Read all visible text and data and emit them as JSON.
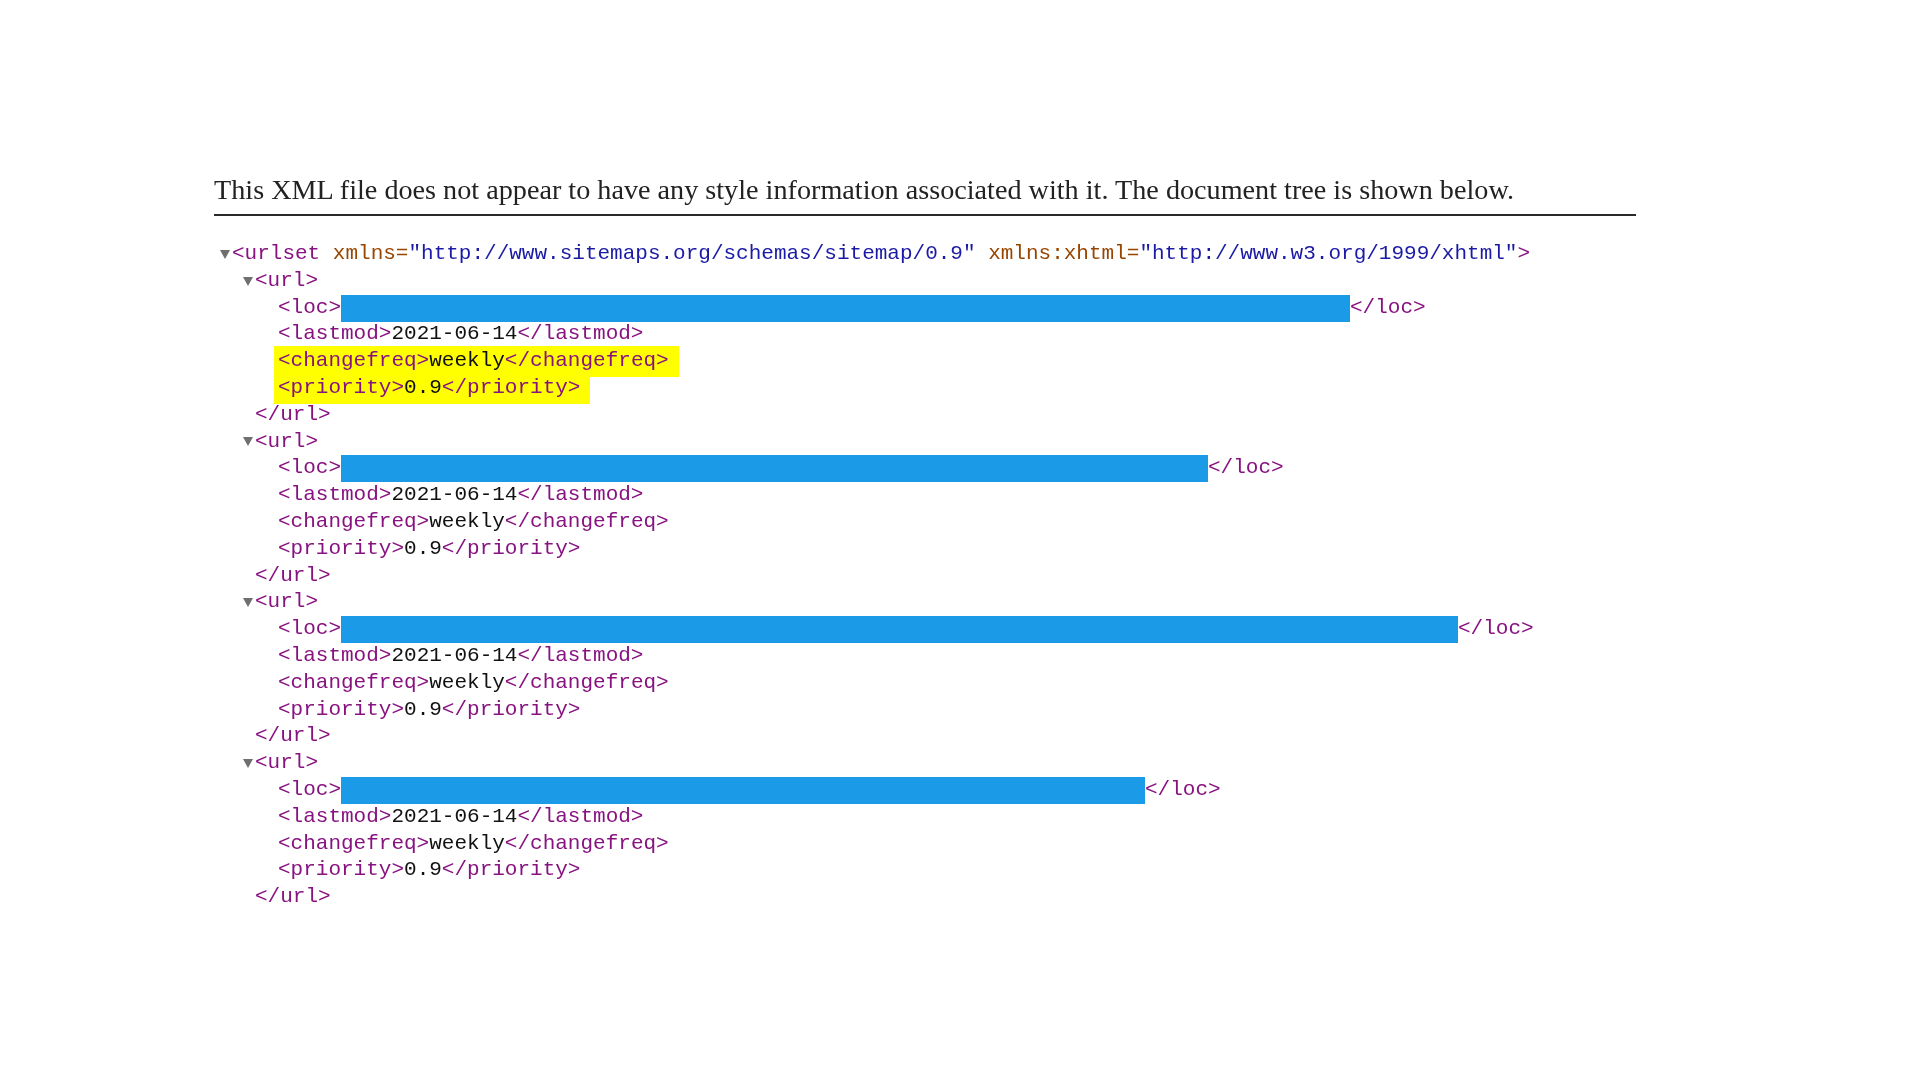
{
  "notice": "This XML file does not appear to have any style information associated with it. The document tree is shown below.",
  "tree": [
    {
      "kind": "element",
      "expanded": true,
      "open": [
        {
          "kind": "tag",
          "text": "<urlset"
        },
        {
          "kind": "attr-name",
          "text": "xmlns="
        },
        {
          "kind": "attr-value",
          "text": "\"http://www.sitemaps.org/schemas/sitemap/0.9\""
        },
        {
          "kind": "attr-name",
          "text": "xmlns:xhtml="
        },
        {
          "kind": "attr-value",
          "text": "\"http://www.w3.org/1999/xhtml\""
        },
        {
          "kind": "tag",
          "text": ">"
        }
      ],
      "children": [
        {
          "kind": "element",
          "expanded": true,
          "open": [
            {
              "kind": "tag",
              "text": "<url>"
            }
          ],
          "close": "</url>",
          "children": [
            {
              "kind": "redacted-line",
              "parts": [
                {
                  "kind": "tag",
                  "text": "<loc>"
                },
                {
                  "kind": "redaction"
                },
                {
                  "kind": "tag",
                  "text": "</loc>"
                }
              ]
            },
            {
              "kind": "text-line",
              "highlighted": false,
              "parts": [
                {
                  "kind": "tag",
                  "text": "<lastmod>"
                },
                {
                  "kind": "text",
                  "text": "2021-06-14"
                },
                {
                  "kind": "tag",
                  "text": "</lastmod>"
                }
              ]
            },
            {
              "kind": "text-line",
              "highlighted": true,
              "parts": [
                {
                  "kind": "tag",
                  "text": "<changefreq>"
                },
                {
                  "kind": "text",
                  "text": "weekly"
                },
                {
                  "kind": "tag",
                  "text": "</changefreq>"
                }
              ]
            },
            {
              "kind": "text-line",
              "highlighted": true,
              "parts": [
                {
                  "kind": "tag",
                  "text": "<priority>"
                },
                {
                  "kind": "text",
                  "text": "0.9"
                },
                {
                  "kind": "tag",
                  "text": "</priority>"
                }
              ]
            }
          ]
        },
        {
          "kind": "element",
          "expanded": true,
          "open": [
            {
              "kind": "tag",
              "text": "<url>"
            }
          ],
          "close": "</url>",
          "children": [
            {
              "kind": "redacted-line",
              "parts": [
                {
                  "kind": "tag",
                  "text": "<loc>"
                },
                {
                  "kind": "redaction"
                },
                {
                  "kind": "tag",
                  "text": "</loc>"
                }
              ]
            },
            {
              "kind": "text-line",
              "highlighted": false,
              "parts": [
                {
                  "kind": "tag",
                  "text": "<lastmod>"
                },
                {
                  "kind": "text",
                  "text": "2021-06-14"
                },
                {
                  "kind": "tag",
                  "text": "</lastmod>"
                }
              ]
            },
            {
              "kind": "text-line",
              "highlighted": false,
              "parts": [
                {
                  "kind": "tag",
                  "text": "<changefreq>"
                },
                {
                  "kind": "text",
                  "text": "weekly"
                },
                {
                  "kind": "tag",
                  "text": "</changefreq>"
                }
              ]
            },
            {
              "kind": "text-line",
              "highlighted": false,
              "parts": [
                {
                  "kind": "tag",
                  "text": "<priority>"
                },
                {
                  "kind": "text",
                  "text": "0.9"
                },
                {
                  "kind": "tag",
                  "text": "</priority>"
                }
              ]
            }
          ]
        },
        {
          "kind": "element",
          "expanded": true,
          "open": [
            {
              "kind": "tag",
              "text": "<url>"
            }
          ],
          "close": "</url>",
          "children": [
            {
              "kind": "redacted-line",
              "parts": [
                {
                  "kind": "tag",
                  "text": "<loc>"
                },
                {
                  "kind": "redaction"
                },
                {
                  "kind": "tag",
                  "text": "</loc>"
                }
              ]
            },
            {
              "kind": "text-line",
              "highlighted": false,
              "parts": [
                {
                  "kind": "tag",
                  "text": "<lastmod>"
                },
                {
                  "kind": "text",
                  "text": "2021-06-14"
                },
                {
                  "kind": "tag",
                  "text": "</lastmod>"
                }
              ]
            },
            {
              "kind": "text-line",
              "highlighted": false,
              "parts": [
                {
                  "kind": "tag",
                  "text": "<changefreq>"
                },
                {
                  "kind": "text",
                  "text": "weekly"
                },
                {
                  "kind": "tag",
                  "text": "</changefreq>"
                }
              ]
            },
            {
              "kind": "text-line",
              "highlighted": false,
              "parts": [
                {
                  "kind": "tag",
                  "text": "<priority>"
                },
                {
                  "kind": "text",
                  "text": "0.9"
                },
                {
                  "kind": "tag",
                  "text": "</priority>"
                }
              ]
            }
          ]
        },
        {
          "kind": "element",
          "expanded": true,
          "open": [
            {
              "kind": "tag",
              "text": "<url>"
            }
          ],
          "close": "</url>",
          "children": [
            {
              "kind": "redacted-line",
              "parts": [
                {
                  "kind": "tag",
                  "text": "<loc>"
                },
                {
                  "kind": "redaction"
                },
                {
                  "kind": "tag",
                  "text": "</loc>"
                }
              ]
            },
            {
              "kind": "text-line",
              "highlighted": false,
              "parts": [
                {
                  "kind": "tag",
                  "text": "<lastmod>"
                },
                {
                  "kind": "text",
                  "text": "2021-06-14"
                },
                {
                  "kind": "tag",
                  "text": "</lastmod>"
                }
              ]
            },
            {
              "kind": "text-line",
              "highlighted": false,
              "parts": [
                {
                  "kind": "tag",
                  "text": "<changefreq>"
                },
                {
                  "kind": "text",
                  "text": "weekly"
                },
                {
                  "kind": "tag",
                  "text": "</changefreq>"
                }
              ]
            },
            {
              "kind": "text-line",
              "highlighted": false,
              "parts": [
                {
                  "kind": "tag",
                  "text": "<priority>"
                },
                {
                  "kind": "text",
                  "text": "0.9"
                },
                {
                  "kind": "tag",
                  "text": "</priority>"
                }
              ]
            }
          ]
        }
      ]
    }
  ]
}
